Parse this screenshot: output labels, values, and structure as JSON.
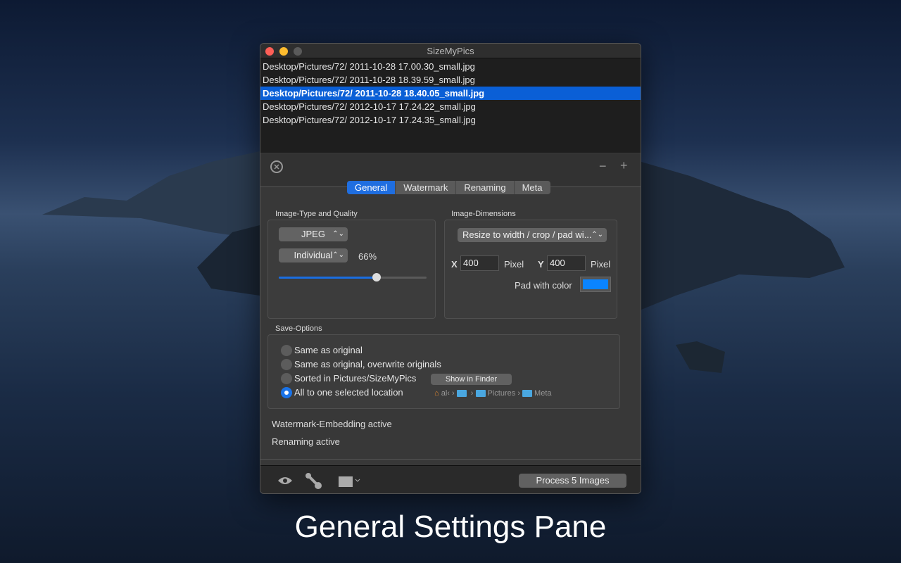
{
  "window": {
    "title": "SizeMyPics"
  },
  "files": [
    "Desktop/Pictures/72/ 2011-10-28 17.00.30_small.jpg",
    "Desktop/Pictures/72/ 2011-10-28 18.39.59_small.jpg",
    "Desktop/Pictures/72/ 2011-10-28 18.40.05_small.jpg",
    "Desktop/Pictures/72/ 2012-10-17 17.24.22_small.jpg",
    "Desktop/Pictures/72/ 2012-10-17 17.24.35_small.jpg"
  ],
  "toolbar": {
    "minus": "−",
    "plus": "+"
  },
  "tabs": [
    "General",
    "Watermark",
    "Renaming",
    "Meta"
  ],
  "quality": {
    "label": "Image-Type and Quality",
    "type": "JPEG",
    "mode": "Individual",
    "percent_label": "66%",
    "value": 66
  },
  "dimensions": {
    "label": "Image-Dimensions",
    "mode": "Resize to width / crop / pad wi...",
    "x_label": "X",
    "x": "400",
    "y_label": "Y",
    "y": "400",
    "unit": "Pixel",
    "pad_label": "Pad with color",
    "pad_color": "#0a84ff"
  },
  "save": {
    "label": "Save-Options",
    "options": [
      "Same as original",
      "Same as original, overwrite originals",
      "Sorted in Pictures/SizeMyPics",
      "All to one selected location"
    ],
    "selected": 3,
    "show_finder": "Show in Finder",
    "path": [
      "al‹",
      "",
      "Pictures",
      "Meta"
    ]
  },
  "status": [
    "Watermark-Embedding active",
    "Renaming active"
  ],
  "process_button": "Process 5 Images",
  "caption": "General Settings Pane"
}
